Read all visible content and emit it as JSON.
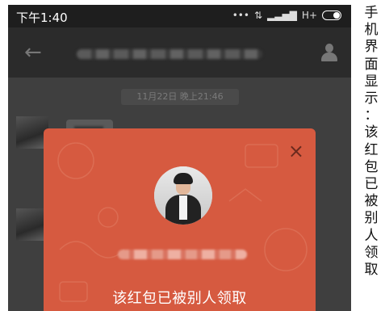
{
  "status_bar": {
    "time": "下午1:40",
    "network": "H+"
  },
  "chat": {
    "timestamp": "11月22日 晚上21:46"
  },
  "red_packet": {
    "status_text": "该红包已被别人领取",
    "close_symbol": "×"
  },
  "caption": {
    "text": "手机界面显示：该红包已被别人领取"
  },
  "colors": {
    "card_red": "#d65a40",
    "dim_overlay": "#3f3f3f"
  },
  "icons": [
    "back-arrow-icon",
    "person-icon",
    "close-icon",
    "signal-icon",
    "wifi-icon",
    "battery-icon"
  ]
}
